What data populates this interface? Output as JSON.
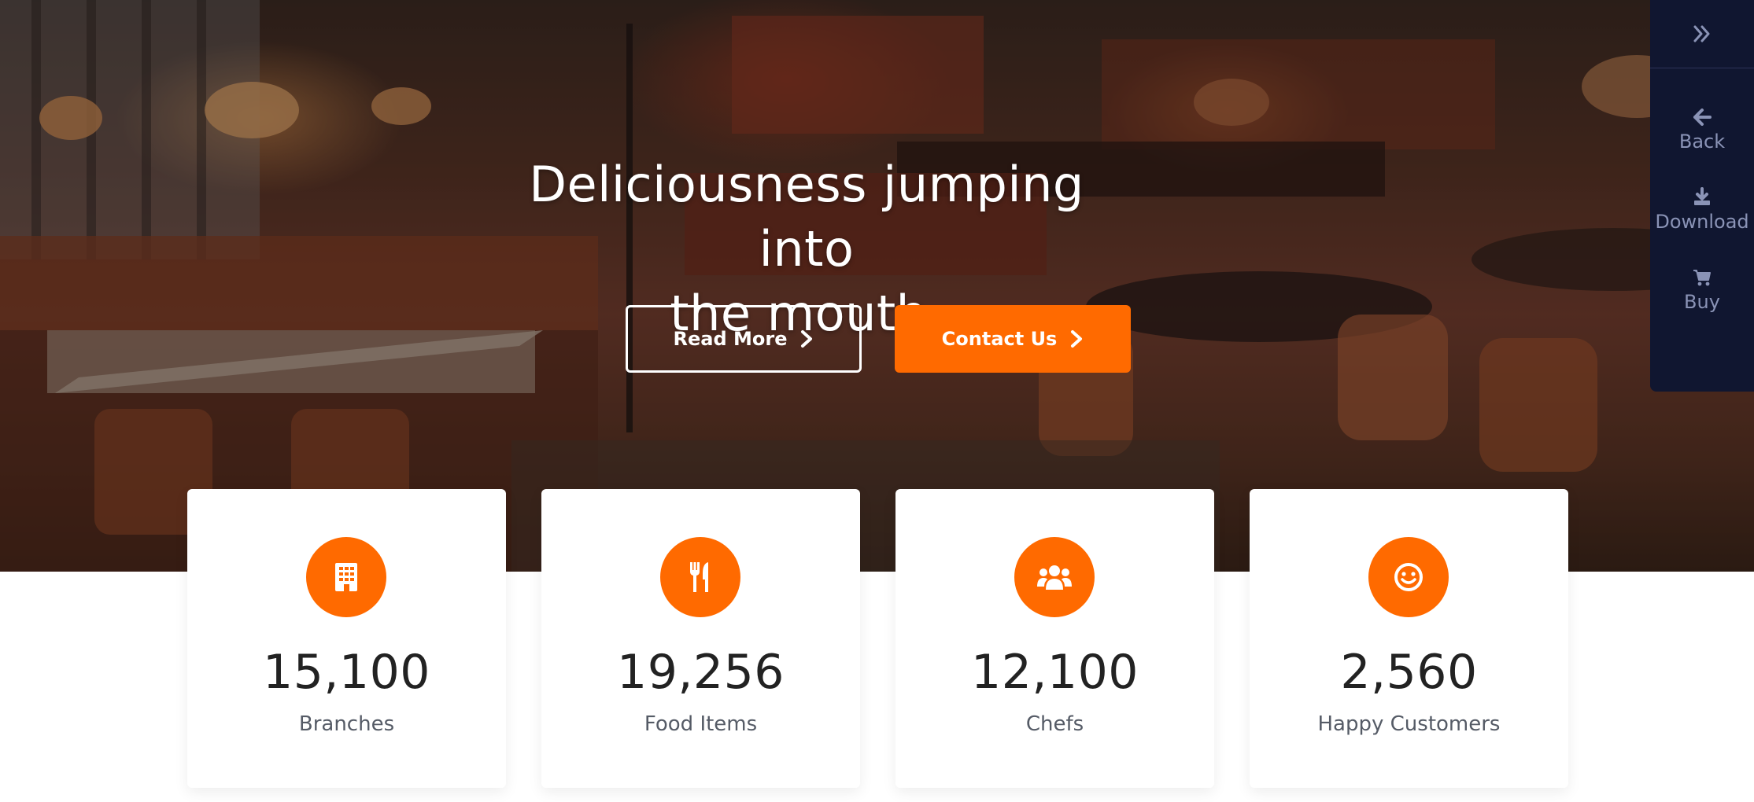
{
  "hero": {
    "title_line1": "Deliciousness jumping into",
    "title_line2": "the mouth.",
    "read_more_label": "Read More",
    "contact_label": "Contact Us",
    "accent_color": "#ff6a00"
  },
  "side_panel": {
    "toggle_icon": "double-chevron-right-icon",
    "items": [
      {
        "label": "Back",
        "icon": "arrow-left-icon"
      },
      {
        "label": "Download",
        "icon": "download-icon"
      },
      {
        "label": "Buy",
        "icon": "cart-icon"
      }
    ],
    "background_color": "#101630"
  },
  "stats": [
    {
      "value": "15,100",
      "label": "Branches",
      "icon": "building-icon"
    },
    {
      "value": "19,256",
      "label": "Food Items",
      "icon": "utensils-icon"
    },
    {
      "value": "12,100",
      "label": "Chefs",
      "icon": "users-icon"
    },
    {
      "value": "2,560",
      "label": "Happy Customers",
      "icon": "smile-icon"
    }
  ]
}
